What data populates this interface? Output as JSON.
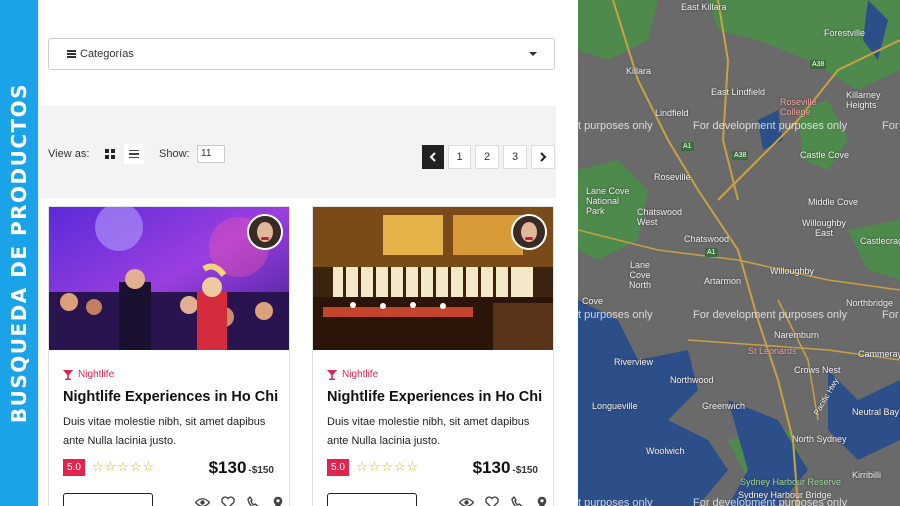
{
  "side_banner": {
    "text": "BUSQUEDA DE PRODUCTOS",
    "color": "#1aa3e8"
  },
  "categories": {
    "label": "Categorías"
  },
  "toolbar": {
    "view_as": "View as:",
    "show_label": "Show:",
    "show_value": "11"
  },
  "pagination": {
    "pages": [
      "1",
      "2",
      "3"
    ]
  },
  "cards": [
    {
      "category": "Nightlife",
      "title": "Nightlife Experiences in Ho Chi",
      "description": "Duis vitae molestie nibh, sit amet dapibus ante Nulla lacinia justo.",
      "rating": "5.0",
      "stars": "☆☆☆☆☆",
      "price": "$130",
      "price_range": "-$150"
    },
    {
      "category": "Nightlife",
      "title": "Nightlife Experiences in Ho Chi",
      "description": "Duis vitae molestie nibh, sit amet dapibus ante Nulla lacinia justo.",
      "rating": "5.0",
      "stars": "☆☆☆☆☆",
      "price": "$130",
      "price_range": "-$150"
    }
  ],
  "map": {
    "dev_watermark": "For development purposes only",
    "dev_watermark_partial_left": "t purposes only",
    "dev_watermark_partial_right": "For",
    "places": {
      "east_killara": "East Killara",
      "forestville": "Forestville",
      "killara": "Killara",
      "east_lindfield": "East Lindfield",
      "killarney_heights": "Killarney Heights",
      "lindfield": "Lindfield",
      "roseville_college": "Roseville College",
      "castle_cove": "Castle Cove",
      "roseville": "Roseville",
      "lane_cove_np": "Lane Cove National Park",
      "chatswood_west": "Chatswood West",
      "middle_cove": "Middle Cove",
      "willoughby_east": "Willoughby East",
      "chatswood": "Chatswood",
      "castlecrag": "Castlecrag",
      "lane_cove_north": "Lane Cove North",
      "willoughby": "Willoughby",
      "artarmon": "Artarmon",
      "lane_cove": "Cove",
      "northbridge": "Northbridge",
      "naremburn": "Naremburn",
      "st_leonards": "St Leonards",
      "cammeray": "Cammeray",
      "riverview": "Riverview",
      "crows_nest": "Crows Nest",
      "northwood": "Northwood",
      "neutral_bay": "Neutral Bay",
      "longueville": "Longueville",
      "greenwich": "Greenwich",
      "north_sydney": "North Sydney",
      "woolwich": "Woolwich",
      "kirribilli": "Kirribilli",
      "harbour_reserve": "Sydney Harbour Reserve",
      "harbour_bridge": "Sydney Harbour Bridge",
      "pacific_hwy": "Pacific Hwy",
      "a38": "A38",
      "a1": "A1"
    },
    "colors": {
      "land": "#6a6a6a",
      "water": "#2c4f8a",
      "park": "#4e8a4c",
      "road": "#c9a244"
    }
  }
}
